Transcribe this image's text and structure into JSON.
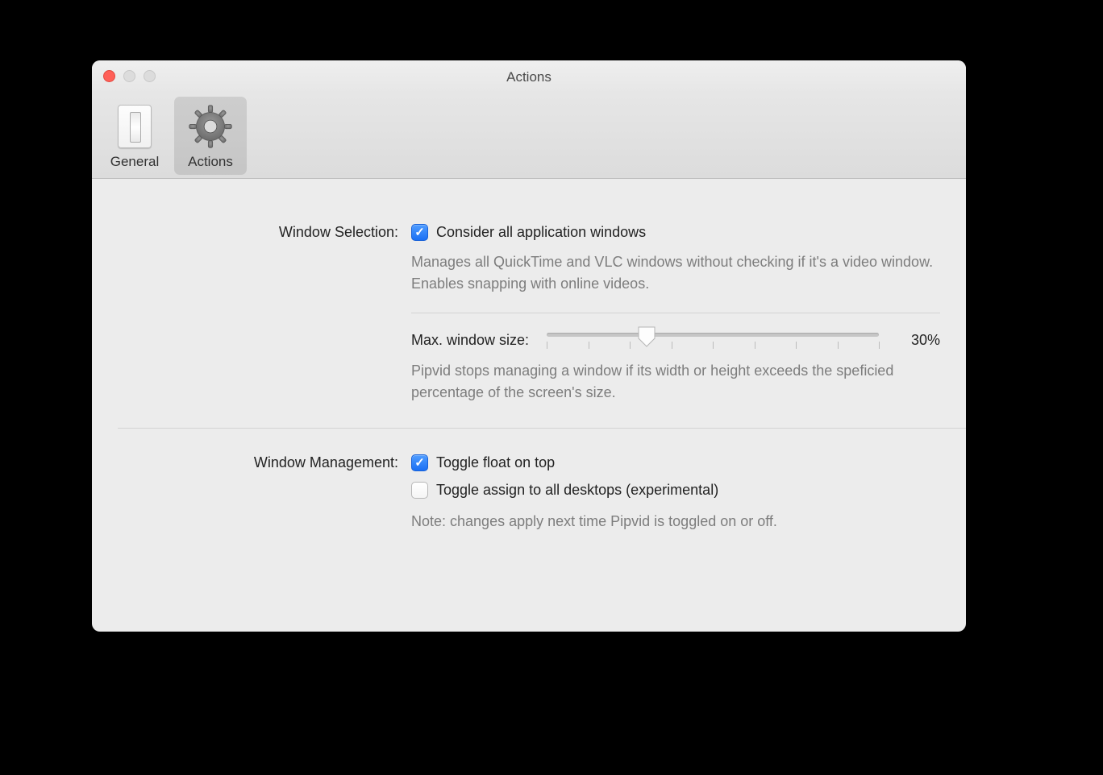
{
  "window": {
    "title": "Actions"
  },
  "tabs": {
    "general": {
      "label": "General"
    },
    "actions": {
      "label": "Actions"
    }
  },
  "section_window_selection": {
    "label": "Window Selection:",
    "checkbox_consider_all": {
      "label": "Consider all application windows",
      "checked": true
    },
    "desc": "Manages all QuickTime and VLC windows without checking if it's a video window. Enables snapping with online videos.",
    "slider": {
      "label": "Max. window size:",
      "value_pct": 30,
      "value_display": "30%",
      "min": 0,
      "max": 100,
      "tick_count": 9
    },
    "slider_desc": "Pipvid stops managing a window if its width or height exceeds the speficied percentage of the screen's size."
  },
  "section_window_management": {
    "label": "Window Management:",
    "checkbox_float_on_top": {
      "label": "Toggle float on top",
      "checked": true
    },
    "checkbox_all_desktops": {
      "label": "Toggle assign to all desktops (experimental)",
      "checked": false
    },
    "note": "Note: changes apply next time Pipvid is toggled on or off."
  },
  "colors": {
    "accent": "#1a6ff4",
    "window_bg": "#ececec",
    "desc_text": "#7d7d7d"
  }
}
